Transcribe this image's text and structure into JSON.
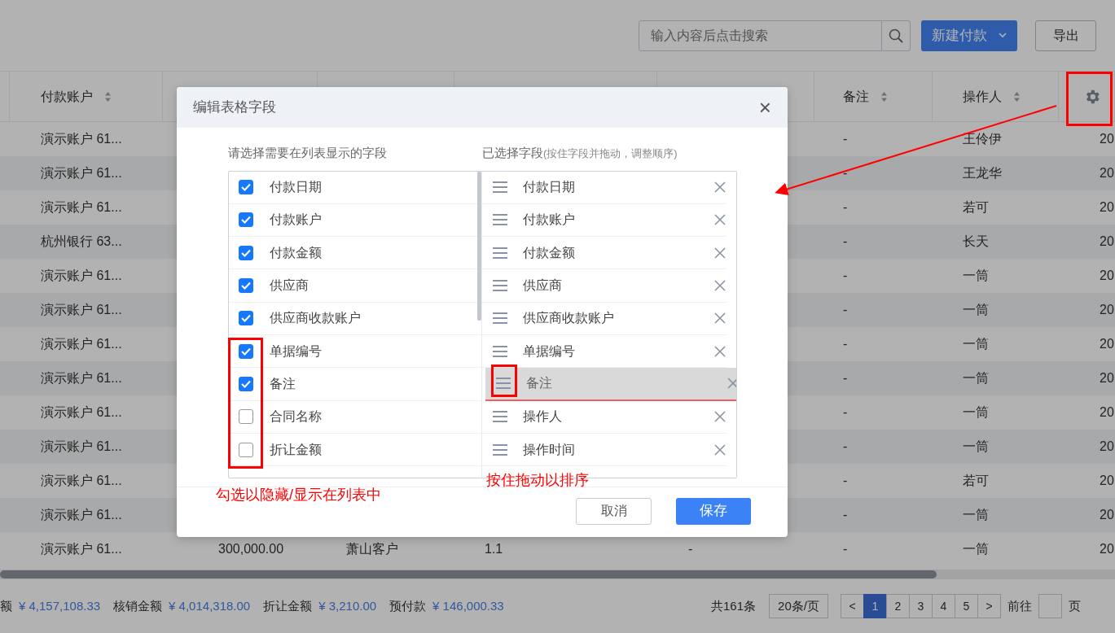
{
  "toolbar": {
    "search": {
      "placeholder": "输入内容后点击搜索"
    },
    "new_button": "新建付款",
    "export_button": "导出"
  },
  "table": {
    "columns": [
      null,
      {
        "label": "付款账户",
        "sortable": true
      },
      null,
      null,
      null,
      null,
      {
        "label": "备注",
        "sortable": true
      },
      {
        "label": "操作人",
        "sortable": true
      },
      {
        "kind": "settings"
      }
    ],
    "rows": [
      {
        "cells": [
          null,
          "演示账户 61...",
          null,
          null,
          null,
          null,
          "-",
          "王伶伊",
          "20"
        ]
      },
      {
        "cells": [
          null,
          "演示账户 61...",
          null,
          null,
          null,
          null,
          "-",
          "王龙华",
          "20"
        ]
      },
      {
        "cells": [
          null,
          "演示账户 61...",
          null,
          null,
          null,
          null,
          "-",
          "若可",
          "20"
        ]
      },
      {
        "cells": [
          null,
          "杭州银行 63...",
          null,
          null,
          null,
          null,
          "-",
          "长天",
          "20"
        ]
      },
      {
        "cells": [
          null,
          "演示账户 61...",
          null,
          null,
          null,
          null,
          "-",
          "一筒",
          "20"
        ]
      },
      {
        "cells": [
          null,
          "演示账户 61...",
          null,
          null,
          null,
          null,
          "-",
          "一筒",
          "20"
        ]
      },
      {
        "cells": [
          null,
          "演示账户 61...",
          null,
          null,
          null,
          null,
          "-",
          "一筒",
          "20"
        ]
      },
      {
        "cells": [
          null,
          "演示账户 61...",
          null,
          null,
          null,
          null,
          "-",
          "一筒",
          "20"
        ]
      },
      {
        "cells": [
          null,
          "演示账户 61...",
          null,
          null,
          null,
          null,
          "-",
          "一筒",
          "20"
        ]
      },
      {
        "cells": [
          null,
          "演示账户 61...",
          null,
          null,
          null,
          null,
          "-",
          "一筒",
          "20"
        ]
      },
      {
        "cells": [
          null,
          "演示账户 61...",
          null,
          null,
          null,
          null,
          "-",
          "若可",
          "20"
        ]
      },
      {
        "cells": [
          null,
          "演示账户 61...",
          null,
          null,
          null,
          null,
          "-",
          "一筒",
          "20"
        ]
      },
      {
        "cells": [
          null,
          "演示账户 61...",
          "300,000.00",
          "萧山客户",
          "1.1",
          "-",
          "-",
          "一筒",
          "20"
        ]
      }
    ]
  },
  "summary": [
    {
      "label": "额",
      "value": "¥ 4,157,108.33"
    },
    {
      "label": "核销金额",
      "value": "¥ 4,014,318.00"
    },
    {
      "label": "折让金额",
      "value": "¥ 3,210.00"
    },
    {
      "label": "预付款",
      "value": "¥ 146,000.33"
    }
  ],
  "pagination": {
    "total": "共161条",
    "page_size": "20条/页",
    "prev": "<",
    "pages": [
      {
        "label": "1",
        "selected": true
      },
      {
        "label": "2",
        "selected": false
      },
      {
        "label": "3",
        "selected": false
      },
      {
        "label": "4",
        "selected": false
      },
      {
        "label": "5",
        "selected": false
      }
    ],
    "next": ">",
    "goto_label": "前往",
    "goto_suffix": "页"
  },
  "dialog": {
    "title": "编辑表格字段",
    "close": "×",
    "left_title": "请选择需要在列表显示的字段",
    "right_title": "已选择字段",
    "right_hint": "(按住字段并拖动，调整顺序)",
    "fields": [
      {
        "label": "付款日期",
        "checked": true
      },
      {
        "label": "付款账户",
        "checked": true
      },
      {
        "label": "付款金额",
        "checked": true
      },
      {
        "label": "供应商",
        "checked": true
      },
      {
        "label": "供应商收款账户",
        "checked": true
      },
      {
        "label": "单据编号",
        "checked": true
      },
      {
        "label": "备注",
        "checked": true
      },
      {
        "label": "合同名称",
        "checked": false
      },
      {
        "label": "折让金额",
        "checked": false
      }
    ],
    "selected_fields": [
      {
        "label": "付款日期",
        "dragging": false
      },
      {
        "label": "付款账户",
        "dragging": false
      },
      {
        "label": "付款金额",
        "dragging": false
      },
      {
        "label": "供应商",
        "dragging": false
      },
      {
        "label": "供应商收款账户",
        "dragging": false
      },
      {
        "label": "单据编号",
        "dragging": false
      },
      {
        "label": "备注",
        "dragging": true
      },
      {
        "label": "操作人",
        "dragging": false
      },
      {
        "label": "操作时间",
        "dragging": false
      }
    ],
    "cancel": "取消",
    "save": "保存"
  },
  "annotations": {
    "checkbox_note": "勾选以隐藏/显示在列表中",
    "drag_note": "按住拖动以排序"
  }
}
